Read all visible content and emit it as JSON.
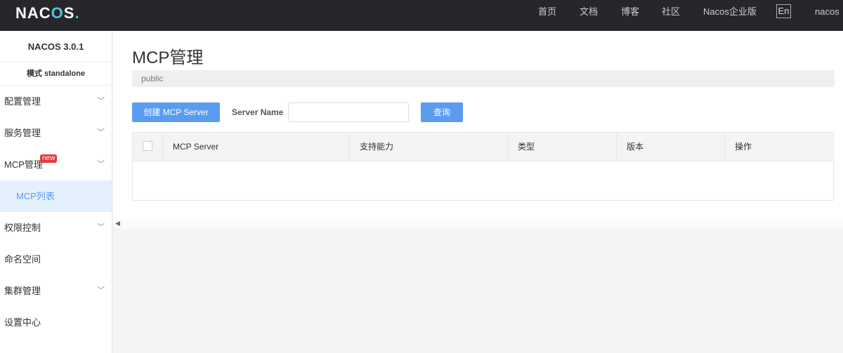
{
  "header": {
    "logo": "NACOS",
    "nav": [
      "首页",
      "文档",
      "博客",
      "社区",
      "Nacos企业版"
    ],
    "lang": "En",
    "user": "nacos"
  },
  "sidebar": {
    "version": "NACOS 3.0.1",
    "mode": "模式 standalone",
    "new_badge": "new",
    "items": [
      "配置管理",
      "服务管理",
      "MCP管理",
      "MCP列表",
      "权限控制",
      "命名空间",
      "集群管理",
      "设置中心"
    ]
  },
  "main": {
    "title": "MCP管理",
    "namespace": "public",
    "create_label": "创建 MCP Server",
    "search_label": "Server Name",
    "search_value": "",
    "query_label": "查询",
    "columns": [
      "MCP Server",
      "支持能力",
      "类型",
      "版本",
      "操作"
    ]
  },
  "colors": {
    "header": "#25272b",
    "accent": "#5b9cf0"
  }
}
